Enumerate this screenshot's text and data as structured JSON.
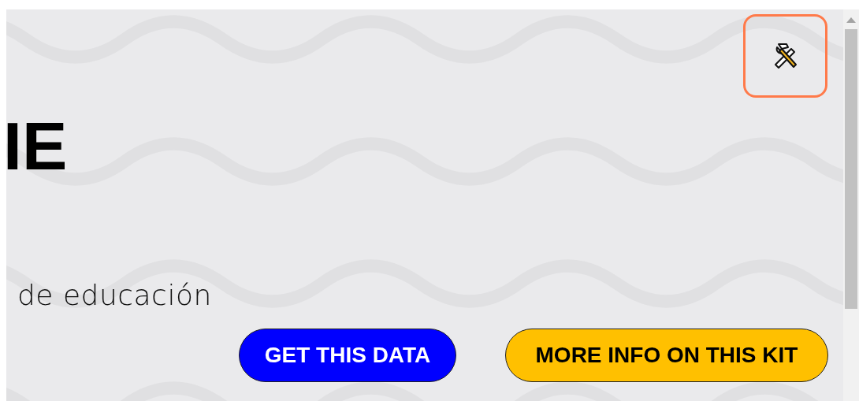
{
  "tools_button": {
    "kind": "tools"
  },
  "heading": "IE",
  "subtitle": "de educación",
  "buttons": [
    {
      "label": "GET THIS DATA",
      "kind": "primary"
    },
    {
      "label": "MORE INFO ON THIS KIT",
      "kind": "secondary"
    }
  ]
}
